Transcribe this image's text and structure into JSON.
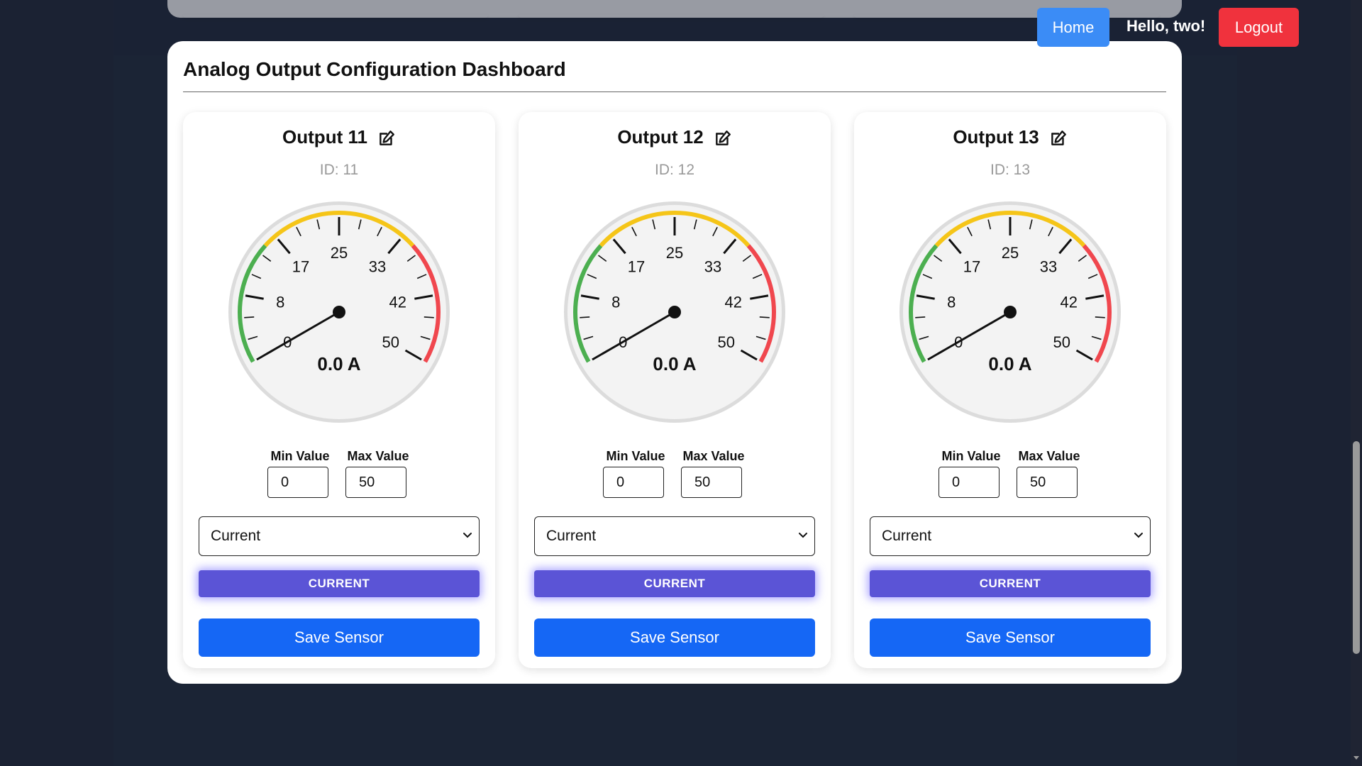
{
  "nav": {
    "home_label": "Home",
    "greeting": "Hello, two!",
    "logout_label": "Logout"
  },
  "dashboard": {
    "title": "Analog Output Configuration Dashboard"
  },
  "gauge_ticks": [
    "0",
    "8",
    "17",
    "25",
    "33",
    "42",
    "50"
  ],
  "outputs": [
    {
      "name": "Output 11",
      "id_text": "ID: 11",
      "reading": "0.0 A",
      "value": 0,
      "min_label": "Min Value",
      "min_value": "0",
      "max_label": "Max Value",
      "max_value": "50",
      "selected_type": "Current",
      "type_badge": "CURRENT",
      "save_label": "Save Sensor"
    },
    {
      "name": "Output 12",
      "id_text": "ID: 12",
      "reading": "0.0 A",
      "value": 0,
      "min_label": "Min Value",
      "min_value": "0",
      "max_label": "Max Value",
      "max_value": "50",
      "selected_type": "Current",
      "type_badge": "CURRENT",
      "save_label": "Save Sensor"
    },
    {
      "name": "Output 13",
      "id_text": "ID: 13",
      "reading": "0.0 A",
      "value": 0,
      "min_label": "Min Value",
      "min_value": "0",
      "max_label": "Max Value",
      "max_value": "50",
      "selected_type": "Current",
      "type_badge": "CURRENT",
      "save_label": "Save Sensor"
    }
  ],
  "colors": {
    "home": "#3b8cf6",
    "logout": "#f0323d",
    "type_badge": "#5b54d6",
    "save": "#1567f5",
    "gauge_green": "#4caf50",
    "gauge_yellow": "#f5c518",
    "gauge_red": "#f0474e"
  }
}
